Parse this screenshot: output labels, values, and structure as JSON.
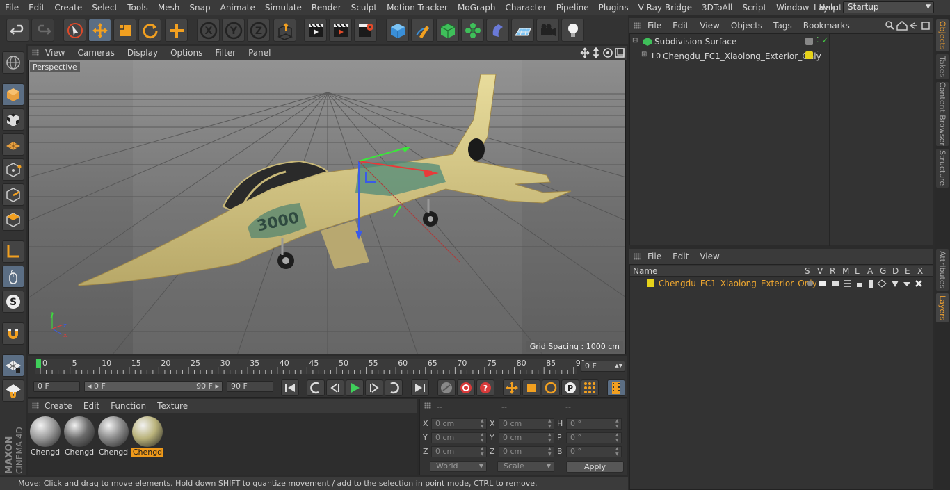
{
  "menubar": {
    "items": [
      "File",
      "Edit",
      "Create",
      "Select",
      "Tools",
      "Mesh",
      "Snap",
      "Animate",
      "Simulate",
      "Render",
      "Sculpt",
      "Motion Tracker",
      "MoGraph",
      "Character",
      "Pipeline",
      "Plugins",
      "V-Ray Bridge",
      "3DToAll",
      "Script",
      "Window",
      "Help"
    ],
    "layout_label": "Layout:",
    "layout_value": "Startup"
  },
  "viewport": {
    "menu": [
      "View",
      "Cameras",
      "Display",
      "Options",
      "Filter",
      "Panel"
    ],
    "label": "Perspective",
    "grid_spacing": "Grid Spacing : 1000 cm",
    "model_text": "3000"
  },
  "timeline": {
    "ticks": [
      "0",
      "5",
      "10",
      "15",
      "20",
      "25",
      "30",
      "35",
      "40",
      "45",
      "50",
      "55",
      "60",
      "65",
      "70",
      "75",
      "80",
      "85",
      "90"
    ],
    "current_frame": "0 F",
    "start_field": "0 F",
    "range_start": "◂ 0 F",
    "range_end": "90 F ▸",
    "end_field": "90 F"
  },
  "material_manager": {
    "menu": [
      "Create",
      "Edit",
      "Function",
      "Texture"
    ],
    "materials": [
      {
        "label": "Chengd",
        "color": "#9a9a9a"
      },
      {
        "label": "Chengd",
        "color": "#6b6b6b"
      },
      {
        "label": "Chengd",
        "color": "#8a8a8a"
      },
      {
        "label": "Chengd",
        "color": "#b9b27a"
      }
    ]
  },
  "coordinates": {
    "headers": [
      "--",
      "--",
      "--"
    ],
    "rows": [
      {
        "a": "X",
        "av": "0 cm",
        "b": "X",
        "bv": "0 cm",
        "c": "H",
        "cv": "0 °"
      },
      {
        "a": "Y",
        "av": "0 cm",
        "b": "Y",
        "bv": "0 cm",
        "c": "P",
        "cv": "0 °"
      },
      {
        "a": "Z",
        "av": "0 cm",
        "b": "Z",
        "bv": "0 cm",
        "c": "B",
        "cv": "0 °"
      }
    ],
    "mode1": "World",
    "mode2": "Scale",
    "apply": "Apply"
  },
  "status": "Move: Click and drag to move elements. Hold down SHIFT to quantize movement / add to the selection in point mode, CTRL to remove.",
  "objects": {
    "menu": [
      "File",
      "Edit",
      "View",
      "Objects",
      "Tags",
      "Bookmarks"
    ],
    "items": [
      {
        "name": "Subdivision Surface"
      },
      {
        "name": "Chengdu_FC1_Xiaolong_Exterior_Only"
      }
    ]
  },
  "layers": {
    "menu": [
      "File",
      "Edit",
      "View"
    ],
    "name_header": "Name",
    "columns": [
      "S",
      "V",
      "R",
      "M",
      "L",
      "A",
      "G",
      "D",
      "E",
      "X"
    ],
    "item": "Chengdu_FC1_Xiaolong_Exterior_Only"
  },
  "side_tabs": [
    "Objects",
    "Takes",
    "Content Browser",
    "Structure",
    "Attributes",
    "Layers"
  ],
  "branding": "MAXON CINEMA 4D",
  "colors": {
    "accent": "#f09a1a",
    "selected_icon": "#5b6e84",
    "layer_yellow": "#e6d21a"
  }
}
